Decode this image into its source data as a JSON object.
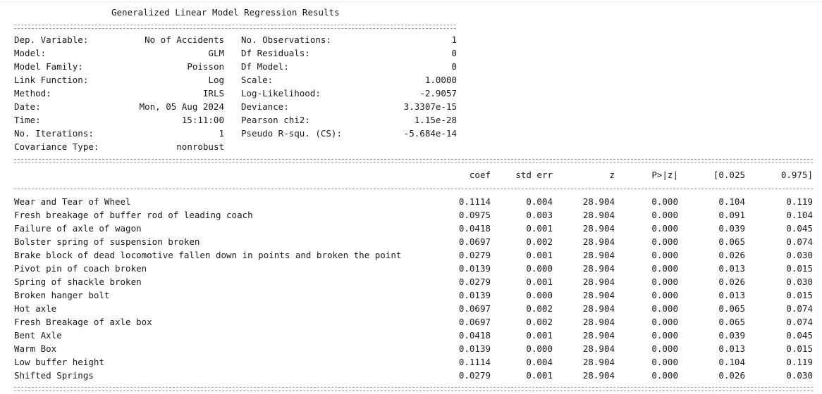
{
  "title": "Generalized Linear Model Regression Results",
  "info_left": [
    {
      "label": "Dep. Variable:",
      "value": "No of Accidents"
    },
    {
      "label": "Model:",
      "value": "GLM"
    },
    {
      "label": "Model Family:",
      "value": "Poisson"
    },
    {
      "label": "Link Function:",
      "value": "Log"
    },
    {
      "label": "Method:",
      "value": "IRLS"
    },
    {
      "label": "Date:",
      "value": "Mon, 05 Aug 2024"
    },
    {
      "label": "Time:",
      "value": "15:11:00"
    },
    {
      "label": "No. Iterations:",
      "value": "1"
    },
    {
      "label": "Covariance Type:",
      "value": "nonrobust"
    }
  ],
  "info_right": [
    {
      "label": "No. Observations:",
      "value": "1"
    },
    {
      "label": "Df Residuals:",
      "value": "0"
    },
    {
      "label": "Df Model:",
      "value": "0"
    },
    {
      "label": "Scale:",
      "value": "1.0000"
    },
    {
      "label": "Log-Likelihood:",
      "value": "-2.9057"
    },
    {
      "label": "Deviance:",
      "value": "3.3307e-15"
    },
    {
      "label": "Pearson chi2:",
      "value": "1.15e-28"
    },
    {
      "label": "Pseudo R-squ. (CS):",
      "value": "-5.684e-14"
    }
  ],
  "columns": [
    "coef",
    "std err",
    "z",
    "P>|z|",
    "[0.025",
    "0.975]"
  ],
  "rows": [
    {
      "name": "Wear and Tear of Wheel",
      "values": [
        "0.1114",
        "0.004",
        "28.904",
        "0.000",
        "0.104",
        "0.119"
      ]
    },
    {
      "name": "Fresh breakage of buffer rod of leading coach",
      "values": [
        "0.0975",
        "0.003",
        "28.904",
        "0.000",
        "0.091",
        "0.104"
      ]
    },
    {
      "name": "Failure of axle of wagon",
      "values": [
        "0.0418",
        "0.001",
        "28.904",
        "0.000",
        "0.039",
        "0.045"
      ]
    },
    {
      "name": "Bolster spring of suspension broken",
      "values": [
        "0.0697",
        "0.002",
        "28.904",
        "0.000",
        "0.065",
        "0.074"
      ]
    },
    {
      "name": "Brake block of dead locomotive fallen down in points and broken the point",
      "values": [
        "0.0279",
        "0.001",
        "28.904",
        "0.000",
        "0.026",
        "0.030"
      ]
    },
    {
      "name": "Pivot pin of coach broken",
      "values": [
        "0.0139",
        "0.000",
        "28.904",
        "0.000",
        "0.013",
        "0.015"
      ]
    },
    {
      "name": "Spring of shackle broken",
      "values": [
        "0.0279",
        "0.001",
        "28.904",
        "0.000",
        "0.026",
        "0.030"
      ]
    },
    {
      "name": "Broken hanger bolt",
      "values": [
        "0.0139",
        "0.000",
        "28.904",
        "0.000",
        "0.013",
        "0.015"
      ]
    },
    {
      "name": "Hot axle",
      "values": [
        "0.0697",
        "0.002",
        "28.904",
        "0.000",
        "0.065",
        "0.074"
      ]
    },
    {
      "name": "Fresh Breakage of axle box",
      "values": [
        "0.0697",
        "0.002",
        "28.904",
        "0.000",
        "0.065",
        "0.074"
      ]
    },
    {
      "name": "Bent Axle",
      "values": [
        "0.0418",
        "0.001",
        "28.904",
        "0.000",
        "0.039",
        "0.045"
      ]
    },
    {
      "name": "Warm Box",
      "values": [
        "0.0139",
        "0.000",
        "28.904",
        "0.000",
        "0.013",
        "0.015"
      ]
    },
    {
      "name": "Low buffer height",
      "values": [
        "0.1114",
        "0.004",
        "28.904",
        "0.000",
        "0.104",
        "0.119"
      ]
    },
    {
      "name": "Shifted Springs",
      "values": [
        "0.0279",
        "0.001",
        "28.904",
        "0.000",
        "0.026",
        "0.030"
      ]
    }
  ]
}
